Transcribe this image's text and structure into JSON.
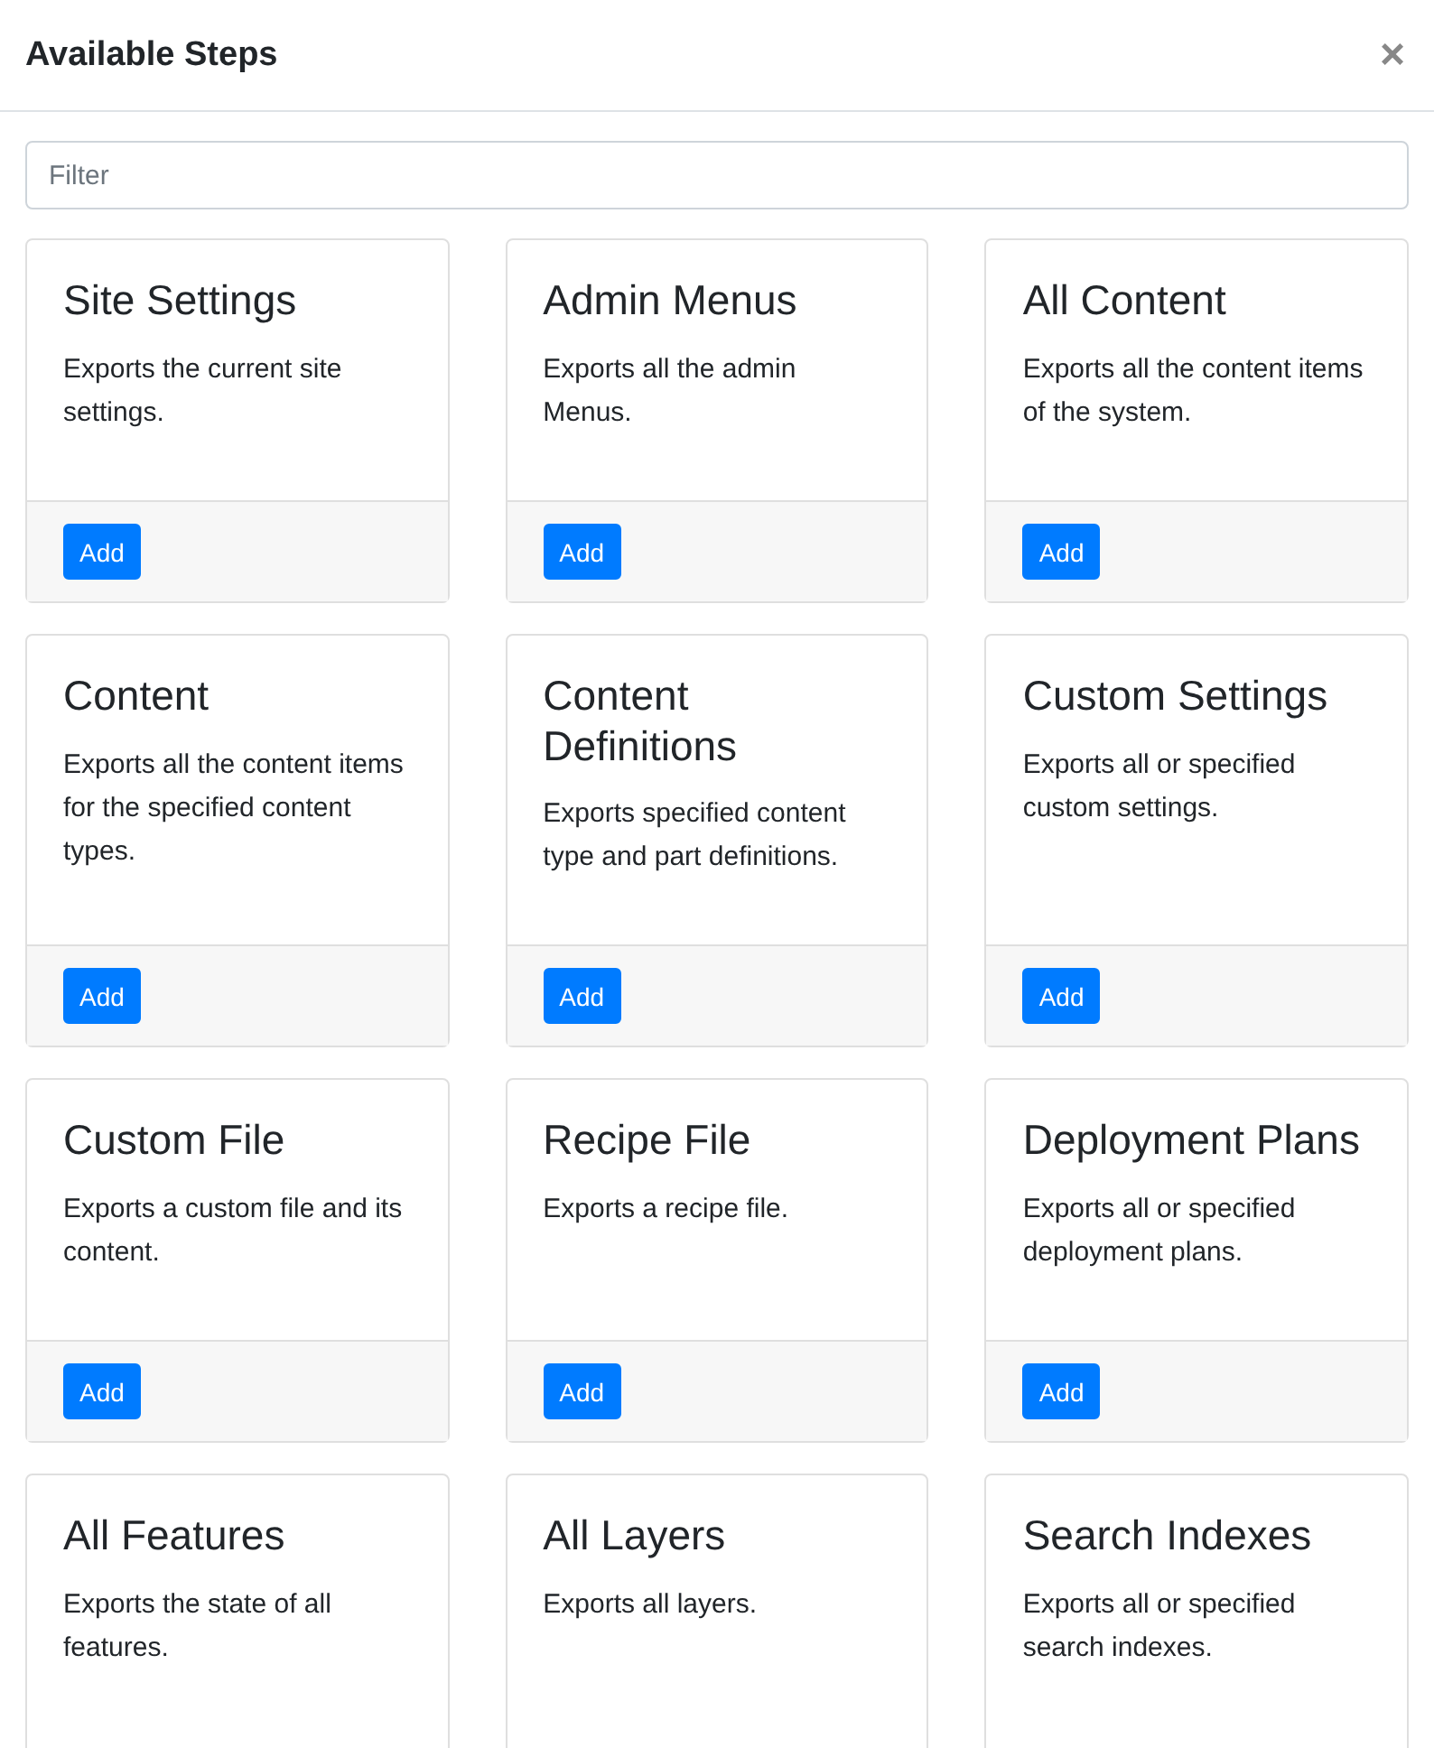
{
  "dialog": {
    "title": "Available Steps",
    "close": "×"
  },
  "filter": {
    "placeholder": "Filter"
  },
  "steps": [
    {
      "title": "Site Settings",
      "description": "Exports the current site settings.",
      "button": "Add"
    },
    {
      "title": "Admin Menus",
      "description": "Exports all the admin Menus.",
      "button": "Add"
    },
    {
      "title": "All Content",
      "description": "Exports all the content items of the system.",
      "button": "Add"
    },
    {
      "title": "Content",
      "description": "Exports all the content items for the specified content types.",
      "button": "Add"
    },
    {
      "title": "Content Definitions",
      "description": "Exports specified content type and part definitions.",
      "button": "Add"
    },
    {
      "title": "Custom Settings",
      "description": "Exports all or specified custom settings.",
      "button": "Add"
    },
    {
      "title": "Custom File",
      "description": "Exports a custom file and its content.",
      "button": "Add"
    },
    {
      "title": "Recipe File",
      "description": "Exports a recipe file.",
      "button": "Add"
    },
    {
      "title": "Deployment Plans",
      "description": "Exports all or specified deployment plans.",
      "button": "Add"
    },
    {
      "title": "All Features",
      "description": "Exports the state of all features."
    },
    {
      "title": "All Layers",
      "description": "Exports all layers."
    },
    {
      "title": "Search Indexes",
      "description": "Exports all or specified search indexes."
    }
  ]
}
